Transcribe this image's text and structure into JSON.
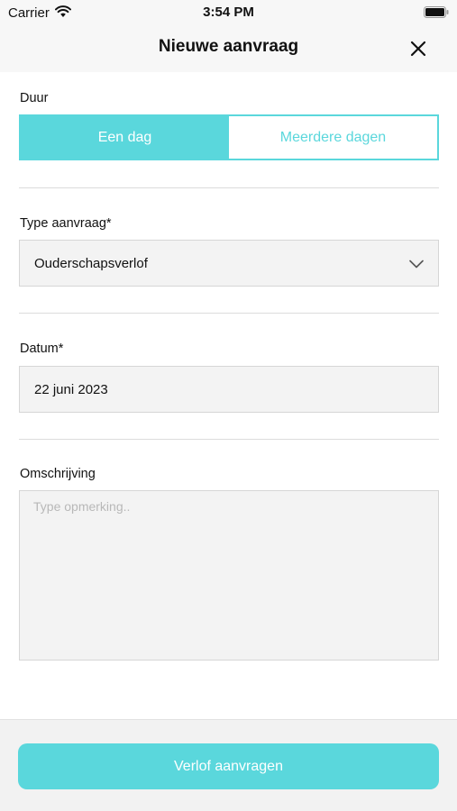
{
  "status_bar": {
    "carrier": "Carrier",
    "time": "3:54 PM"
  },
  "nav": {
    "title": "Nieuwe aanvraag",
    "close_icon": "close-icon"
  },
  "duration": {
    "label": "Duur",
    "options": [
      "Een dag",
      "Meerdere dagen"
    ],
    "selected": "Een dag"
  },
  "request_type": {
    "label": "Type aanvraag*",
    "value": "Ouderschapsverlof"
  },
  "date": {
    "label": "Datum*",
    "value": "22 juni 2023"
  },
  "description": {
    "label": "Omschrijving",
    "placeholder": "Type opmerking.."
  },
  "submit": {
    "label": "Verlof aanvragen"
  },
  "colors": {
    "accent": "#5ad7dc",
    "field_bg": "#f3f3f3",
    "bar_bg": "#f7f7f7"
  }
}
